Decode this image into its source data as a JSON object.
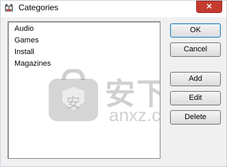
{
  "window": {
    "title": "Categories",
    "close_label": "✕"
  },
  "categories": {
    "items": [
      "Audio",
      "Games",
      "Install",
      "Magazines"
    ]
  },
  "buttons": {
    "ok": "OK",
    "cancel": "Cancel",
    "add": "Add",
    "edit": "Edit",
    "delete": "Delete"
  },
  "watermark": {
    "text": "安下载",
    "domain": "anxz.com",
    "badge_char": "安"
  },
  "colors": {
    "close_button": "#c43b30",
    "default_button_border": "#3c7fb1"
  }
}
